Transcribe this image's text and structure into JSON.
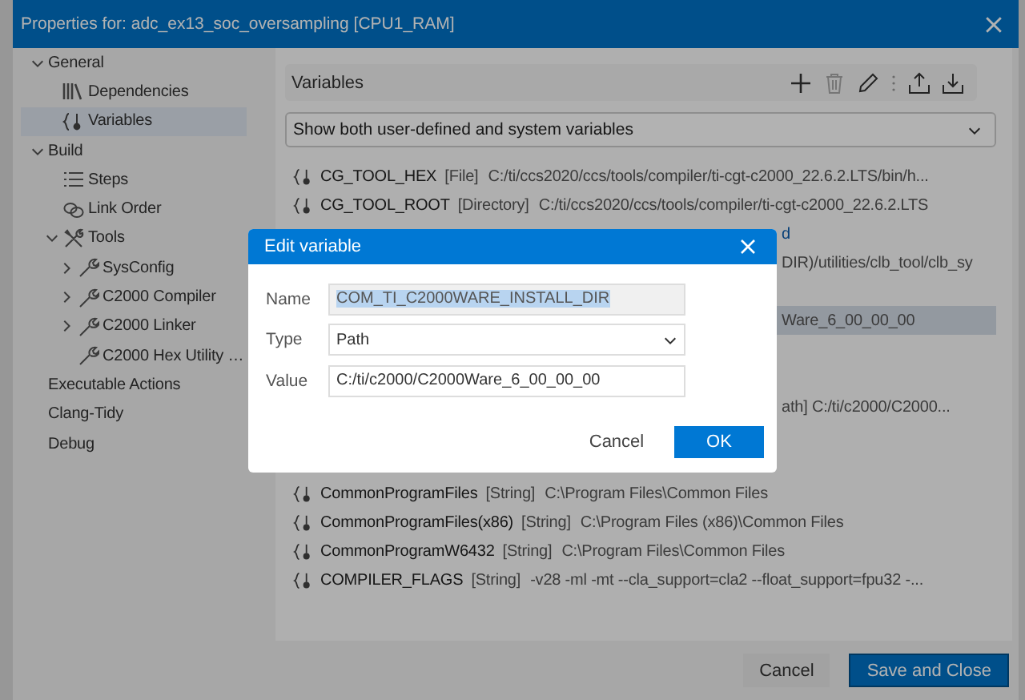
{
  "window": {
    "title": "Properties for: adc_ex13_soc_oversampling [CPU1_RAM]"
  },
  "sidebar": {
    "items": [
      {
        "label": "General",
        "expanded": true,
        "selected": false,
        "children": [
          {
            "label": "Dependencies",
            "kind": "library",
            "selected": false
          },
          {
            "label": "Variables",
            "kind": "variable",
            "selected": true
          }
        ]
      },
      {
        "label": "Build",
        "expanded": true,
        "selected": false,
        "children": [
          {
            "label": "Steps",
            "kind": "list",
            "selected": false
          },
          {
            "label": "Link Order",
            "kind": "link",
            "selected": false
          },
          {
            "label": "Tools",
            "kind": "toolset",
            "expanded": true,
            "selected": false,
            "children": [
              {
                "label": "SysConfig",
                "kind": "tool",
                "expanded": false,
                "selected": false
              },
              {
                "label": "C2000 Compiler",
                "kind": "tool",
                "expanded": false,
                "selected": false
              },
              {
                "label": "C2000 Linker",
                "kind": "tool",
                "expanded": false,
                "selected": false
              },
              {
                "label": "C2000 Hex Utility …",
                "kind": "tool",
                "selected": false
              }
            ]
          }
        ]
      },
      {
        "label": "Executable Actions",
        "selected": false
      },
      {
        "label": "Clang-Tidy",
        "selected": false
      },
      {
        "label": "Debug",
        "selected": false
      }
    ]
  },
  "variables": {
    "title": "Variables",
    "toolbar": [
      {
        "kind": "add",
        "disabled": false
      },
      {
        "kind": "delete",
        "disabled": true
      },
      {
        "kind": "edit",
        "disabled": false
      },
      {
        "kind": "separator"
      },
      {
        "kind": "export",
        "disabled": false
      },
      {
        "kind": "import",
        "disabled": false
      }
    ],
    "filter": {
      "value": "Show both user-defined and system variables"
    },
    "rows": [
      {
        "kind": "variable",
        "name": "CG_TOOL_HEX",
        "type": "[File]",
        "value": "C:/ti/ccs2020/ccs/tools/compiler/ti-cgt-c2000_22.6.2.LTS/bin/h...",
        "selected": false
      },
      {
        "kind": "variable",
        "name": "CG_TOOL_ROOT",
        "type": "[Directory]",
        "value": "C:/ti/ccs2020/ccs/tools/compiler/ti-cgt-c2000_22.6.2.LTS",
        "selected": false
      },
      {
        "kind": "partial_link",
        "text": "d",
        "selected": false
      },
      {
        "kind": "partial",
        "text": "DIR)/utilities/clb_tool/clb_sy",
        "selected": false
      },
      {
        "kind": "hidden",
        "selected": false
      },
      {
        "kind": "partial",
        "text": "Ware_6_00_00_00",
        "selected": true
      },
      {
        "kind": "hidden",
        "selected": false
      },
      {
        "kind": "hidden",
        "selected": false
      },
      {
        "kind": "partial",
        "text": "ath]  C:/ti/c2000/C2000...",
        "selected": false
      },
      {
        "kind": "hidden",
        "selected": false
      },
      {
        "kind": "hidden",
        "selected": false
      },
      {
        "kind": "variable",
        "name": "CommonProgramFiles",
        "type": "[String]",
        "value": "C:\\Program Files\\Common Files",
        "selected": false
      },
      {
        "kind": "variable",
        "name": "CommonProgramFiles(x86)",
        "type": "[String]",
        "value": "C:\\Program Files (x86)\\Common Files",
        "selected": false
      },
      {
        "kind": "variable",
        "name": "CommonProgramW6432",
        "type": "[String]",
        "value": "C:\\Program Files\\Common Files",
        "selected": false
      },
      {
        "kind": "variable",
        "name": "COMPILER_FLAGS",
        "type": "[String]",
        "value": "-v28 -ml -mt --cla_support=cla2 --float_support=fpu32 -...",
        "selected": false
      }
    ]
  },
  "dialog": {
    "title": "Edit variable",
    "fields": [
      {
        "label": "Name",
        "kind": "readonly",
        "value": "COM_TI_C2000WARE_INSTALL_DIR",
        "text_selected": true
      },
      {
        "label": "Type",
        "kind": "select",
        "value": "Path",
        "text_selected": false
      },
      {
        "label": "Value",
        "kind": "text",
        "value": "C:/ti/c2000/C2000Ware_6_00_00_00",
        "text_selected": false
      }
    ],
    "buttons": [
      {
        "label": "Cancel",
        "primary": false
      },
      {
        "label": "OK",
        "primary": true
      }
    ]
  },
  "buttons": [
    {
      "label": "Cancel",
      "primary": false
    },
    {
      "label": "Save and Close",
      "primary": true
    }
  ]
}
